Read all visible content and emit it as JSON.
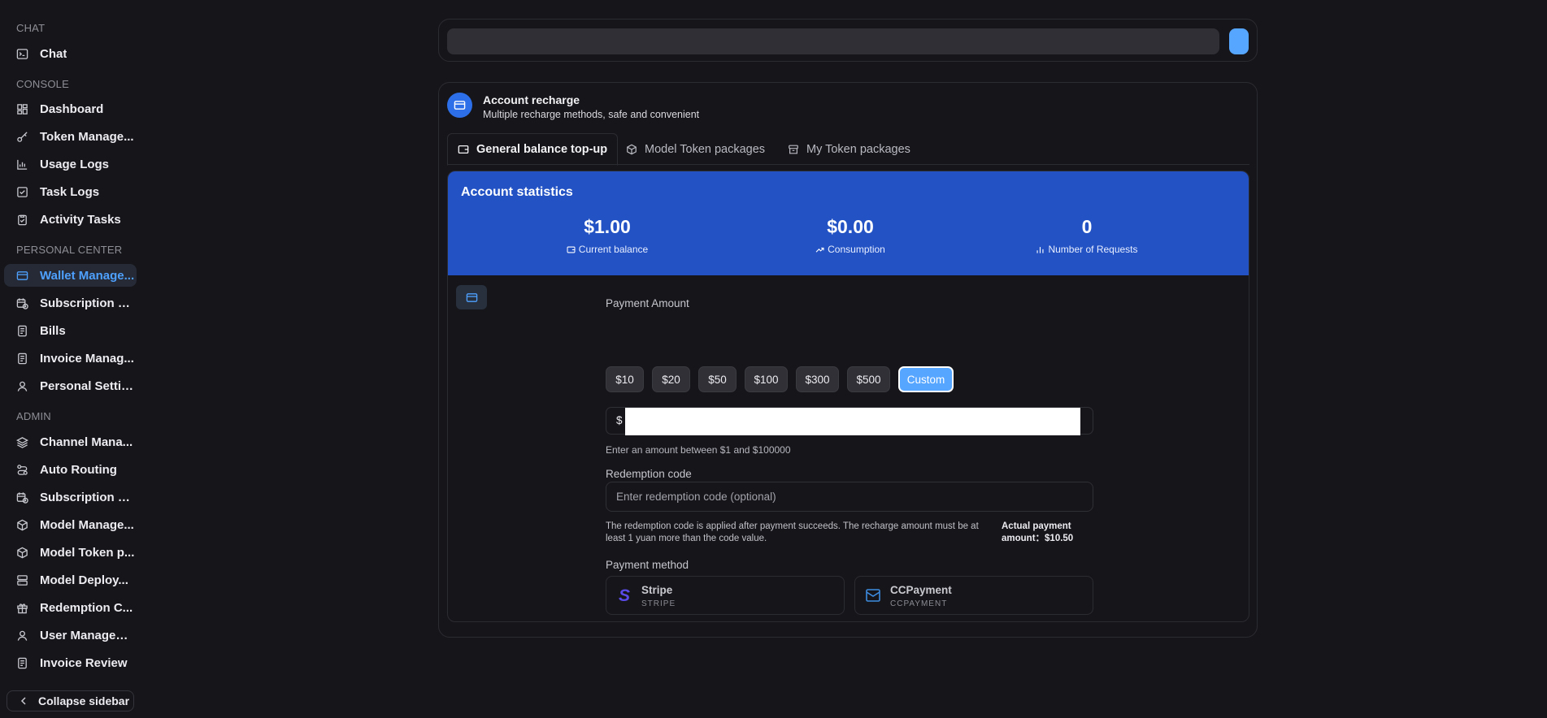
{
  "sidebar": {
    "sections": [
      {
        "title": "CHAT"
      },
      {
        "title": "CONSOLE"
      },
      {
        "title": "PERSONAL CENTER"
      },
      {
        "title": "ADMIN"
      }
    ],
    "items": [
      {
        "label": "Chat",
        "icon": "terminal-icon"
      },
      {
        "label": "Dashboard",
        "icon": "dashboard-icon"
      },
      {
        "label": "Token Manage...",
        "icon": "key-icon"
      },
      {
        "label": "Usage Logs",
        "icon": "bar-chart-icon"
      },
      {
        "label": "Task Logs",
        "icon": "checkbox-icon"
      },
      {
        "label": "Activity Tasks",
        "icon": "clipboard-icon"
      },
      {
        "label": "Wallet Manage...",
        "icon": "wallet-icon",
        "active": true
      },
      {
        "label": "Subscription Pl...",
        "icon": "calendar-clock-icon"
      },
      {
        "label": "Bills",
        "icon": "document-icon"
      },
      {
        "label": "Invoice Manag...",
        "icon": "document-icon"
      },
      {
        "label": "Personal Settin...",
        "icon": "user-icon"
      },
      {
        "label": "Channel Mana...",
        "icon": "layers-icon"
      },
      {
        "label": "Auto Routing",
        "icon": "route-icon"
      },
      {
        "label": "Subscription M...",
        "icon": "calendar-clock-icon"
      },
      {
        "label": "Model Manage...",
        "icon": "cube-icon"
      },
      {
        "label": "Model Token p...",
        "icon": "cube-icon"
      },
      {
        "label": "Model Deploy...",
        "icon": "server-icon"
      },
      {
        "label": "Redemption C...",
        "icon": "gift-icon"
      },
      {
        "label": "User Managem...",
        "icon": "user-icon"
      },
      {
        "label": "Invoice Review",
        "icon": "document-icon"
      }
    ],
    "collapse_label": "Collapse sidebar"
  },
  "card": {
    "title": "Account recharge",
    "subtitle": "Multiple recharge methods, safe and convenient",
    "tabs": [
      {
        "label": "General balance top-up",
        "active": true
      },
      {
        "label": "Model Token packages"
      },
      {
        "label": "My Token packages"
      }
    ]
  },
  "stats": {
    "title": "Account statistics",
    "items": [
      {
        "value": "$1.00",
        "label": "Current balance"
      },
      {
        "value": "$0.00",
        "label": "Consumption"
      },
      {
        "value": "0",
        "label": "Number of Requests"
      }
    ]
  },
  "payment": {
    "amount_label": "Payment Amount",
    "amounts": [
      "$10",
      "$20",
      "$50",
      "$100",
      "$300",
      "$500",
      "Custom"
    ],
    "selected": "Custom",
    "currency_symbol": "$",
    "amount_value": "",
    "amount_hint": "Enter an amount between $1 and $100000",
    "redemption_label": "Redemption code",
    "redemption_placeholder": "Enter redemption code (optional)",
    "redemption_note": "The redemption code is applied after payment succeeds. The recharge amount must be at least 1 yuan more than the code value.",
    "actual_payment": "Actual payment amount：$10.50",
    "method_label": "Payment method",
    "methods": [
      {
        "name": "Stripe",
        "sub": "STRIPE"
      },
      {
        "name": "CCPayment",
        "sub": "CCPAYMENT"
      }
    ]
  },
  "colors": {
    "accent": "#56a6ff",
    "stats_bg": "#2252c4",
    "background": "#16161a"
  }
}
